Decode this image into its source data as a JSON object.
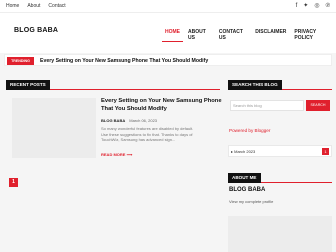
{
  "topbar": {
    "links": [
      "Home",
      "About",
      "Contact"
    ],
    "social": [
      "facebook-icon",
      "twitter-icon",
      "instagram-icon",
      "pinterest-icon"
    ]
  },
  "header": {
    "logo": "BLOG BABA",
    "nav": [
      "HOME",
      "ABOUT US",
      "CONTACT US",
      "DISCLAIMER",
      "PRIVACY POLICY"
    ],
    "active_index": 0
  },
  "ticker": {
    "label": "TRENDING",
    "text": "Every Setting on Your New Samsung Phone That You Should Modify"
  },
  "main": {
    "section_title": "RECENT POSTS",
    "post": {
      "title": "Every Setting on Your New Samsung Phone That You Should Modify",
      "author": "BLOG BABA",
      "date": "March 06, 2023",
      "excerpt": "So many wonderful features are disabled by default. Use these suggestions to fix that. Thanks to days of TouchWiz, Samsung has advanced sign...",
      "read_more": "READ MORE"
    },
    "pager": "1"
  },
  "sidebar": {
    "search_title": "SEARCH THIS BLOG",
    "search_placeholder": "Search this blog",
    "search_button": "SEARCH",
    "powered": "Powered by Blogger",
    "archive_label": "March 2023",
    "about_title": "ABOUT ME",
    "about_name": "BLOG BABA",
    "about_link": "View my complete profile"
  },
  "colors": {
    "accent": "#e0202d",
    "dark": "#111111"
  }
}
